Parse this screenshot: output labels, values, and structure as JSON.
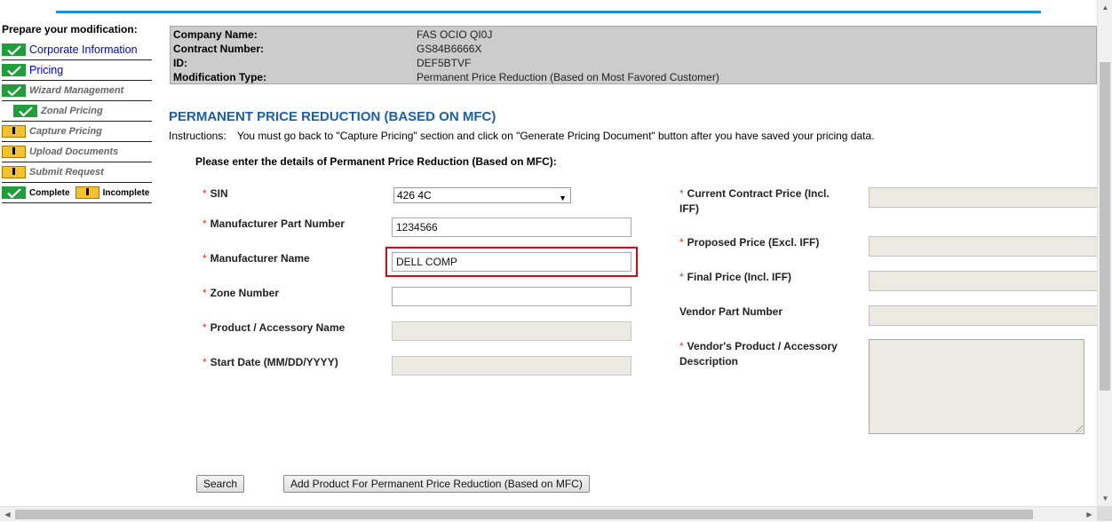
{
  "sidebar": {
    "title": "Prepare your modification:",
    "items": [
      {
        "label": "Corporate Information",
        "status": "complete",
        "style": "link"
      },
      {
        "label": "Pricing",
        "status": "complete",
        "style": "link"
      },
      {
        "label": "Wizard Management",
        "status": "complete",
        "style": "muted"
      },
      {
        "label": "Zonal Pricing",
        "status": "complete",
        "style": "muted"
      },
      {
        "label": "Capture Pricing",
        "status": "incomplete",
        "style": "muted"
      },
      {
        "label": "Upload Documents",
        "status": "incomplete",
        "style": "muted"
      },
      {
        "label": "Submit Request",
        "status": "incomplete",
        "style": "muted"
      }
    ],
    "legend": {
      "complete": "Complete",
      "incomplete": "Incomplete"
    }
  },
  "info": {
    "company_label": "Company Name:",
    "company_value": "FAS OCIO QI0J",
    "contract_label": "Contract Number:",
    "contract_value": "GS84B6666X",
    "id_label": "ID:",
    "id_value": "DEF5BTVF",
    "modtype_label": "Modification Type:",
    "modtype_value": "Permanent Price Reduction (Based on Most Favored Customer)"
  },
  "page_title": "PERMANENT PRICE REDUCTION (BASED ON MFC)",
  "instructions": {
    "label": "Instructions:",
    "text": "You must go back to \"Capture Pricing\" section and click on \"Generate Pricing Document\" button after you have saved your pricing data."
  },
  "form_heading": "Please enter the details of Permanent Price Reduction (Based on MFC):",
  "form": {
    "required_mark": "*",
    "sin_label": "SIN",
    "sin_value": "426 4C",
    "mpn_label": "Manufacturer Part Number",
    "mpn_value": "1234566",
    "mname_label": "Manufacturer Name",
    "mname_value": "DELL COMP",
    "zone_label": "Zone Number",
    "zone_value": "",
    "product_label": "Product / Accessory Name",
    "product_value": "",
    "start_label": "Start Date (MM/DD/YYYY)",
    "start_value": "",
    "ccp_label": "Current Contract Price (Incl. IFF)",
    "pp_label": "Proposed Price (Excl. IFF)",
    "fp_label": "Final Price (Incl. IFF)",
    "vpn_label": "Vendor Part Number",
    "vdesc_label": "Vendor's Product / Accessory Description"
  },
  "buttons": {
    "search": "Search",
    "add": "Add Product For Permanent Price Reduction (Based on MFC)"
  },
  "colors": {
    "accent": "#1a94d0",
    "title": "#1b5fa8",
    "required": "#dd3322",
    "highlight": "#b5191f",
    "complete": "#1f9e3a",
    "incomplete": "#f6c12f"
  },
  "icons": {
    "complete": "check-icon",
    "incomplete": "exclamation-icon"
  }
}
